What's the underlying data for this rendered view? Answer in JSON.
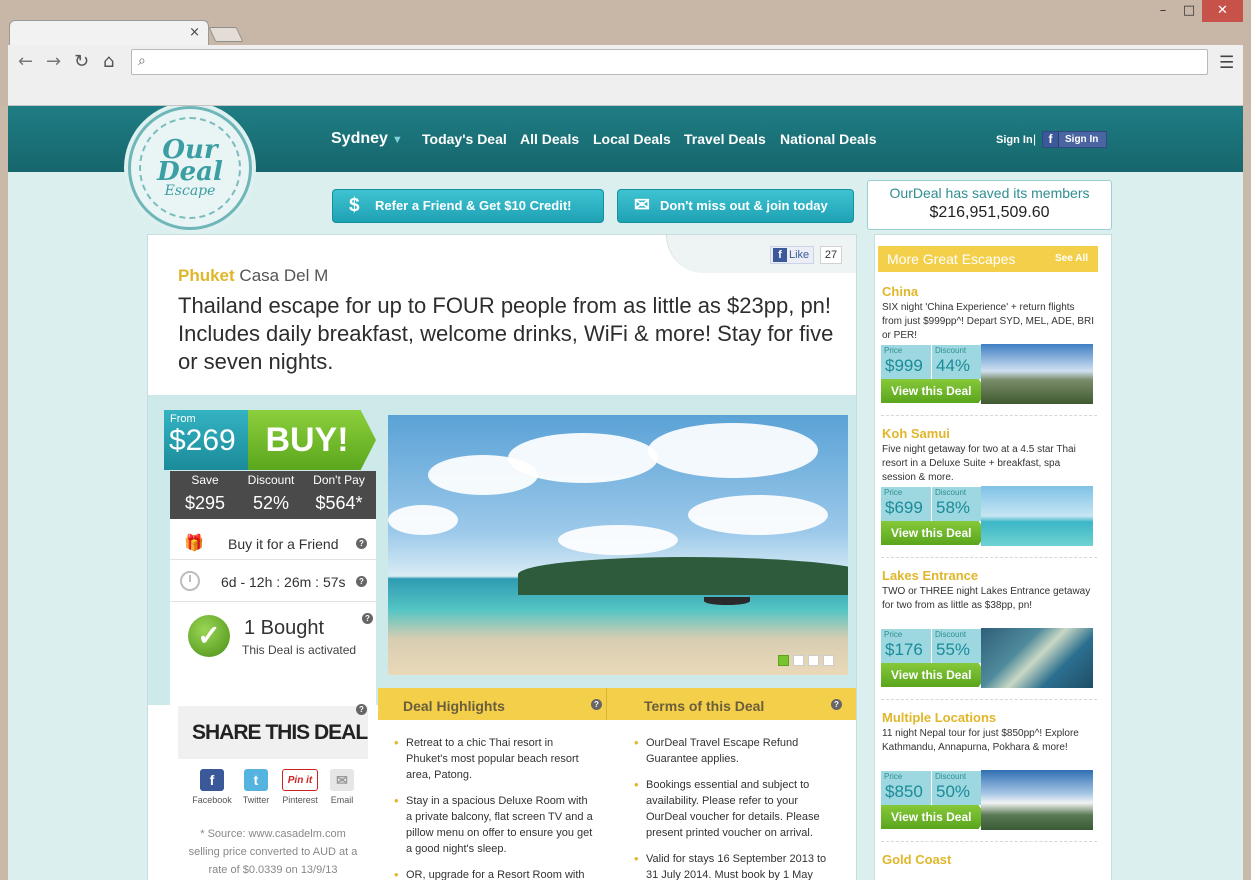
{
  "browser": {
    "tab_close": "×",
    "window_controls": {
      "minimize": "–",
      "maximize": "□",
      "close": "✕"
    },
    "address_value": ""
  },
  "header": {
    "logo_line1": "Our",
    "logo_line2": "Deal",
    "logo_line3": "Escape",
    "city": "Sydney",
    "nav": [
      "Today's Deal",
      "All Deals",
      "Local Deals",
      "Travel Deals",
      "National Deals"
    ],
    "sign_in": "Sign In",
    "fb_sign_in": "Sign In"
  },
  "cta": {
    "refer": "Refer a Friend & Get $10 Credit!",
    "join": "Don't miss out & join today"
  },
  "saved": {
    "label": "OurDeal has saved its members",
    "amount": "$216,951,509.60"
  },
  "deal": {
    "fb_like": "Like",
    "fb_count": "27",
    "location_highlight": "Phuket",
    "location_rest": "Casa Del M",
    "headline": "Thailand escape for up to FOUR people from as little as $23pp, pn! Includes daily breakfast, welcome drinks, WiFi & more! Stay for five or seven nights.",
    "from_label": "From",
    "price": "$269",
    "buy_label": "BUY!",
    "stats": {
      "headers": [
        "Save",
        "Discount",
        "Don't Pay"
      ],
      "values": [
        "$295",
        "52%",
        "$564*"
      ]
    },
    "buy_friend": "Buy it for a Friend",
    "timer": "6d - 12h : 26m : 57s",
    "bought": "1 Bought",
    "activated": "This Deal is activated",
    "share_title": "SHARE THIS DEAL",
    "share": [
      "Facebook",
      "Twitter",
      "Pinterest",
      "Email"
    ],
    "source": "* Source: www.casadelm.com selling price converted to AUD at a rate of $0.0339 on 13/9/13",
    "highlights_title": "Deal Highlights",
    "terms_title": "Terms of this Deal",
    "highlights": [
      "Retreat to a chic Thai resort in Phuket's most popular beach resort area, Patong.",
      "Stay in a spacious Deluxe Room with a private balcony, flat screen TV and a pillow menu on offer to ensure you get a good night's sleep.",
      "OR, upgrade for a Resort Room with"
    ],
    "terms": [
      "OurDeal Travel Escape Refund Guarantee applies.",
      "Bookings essential and subject to availability. Please refer to your OurDeal voucher for details. Please present printed voucher on arrival.",
      "Valid for stays 16 September 2013 to 31 July 2014. Must book by 1 May"
    ]
  },
  "sidebar": {
    "title": "More Great Escapes",
    "see_all": "See All",
    "price_label": "Price",
    "discount_label": "Discount",
    "button_label": "View this Deal",
    "escapes": [
      {
        "title": "China",
        "desc": "SIX night 'China Experience' + return flights from just $999pp^! Depart SYD, MEL, ADE, BRI or PER!",
        "price": "$999",
        "discount": "44%"
      },
      {
        "title": "Koh Samui",
        "desc": "Five night getaway for two at a 4.5 star Thai resort in a Deluxe Suite + breakfast, spa session & more.",
        "price": "$699",
        "discount": "58%"
      },
      {
        "title": "Lakes Entrance",
        "desc": "TWO or THREE night Lakes Entrance getaway for two from as little as $38pp, pn!",
        "price": "$176",
        "discount": "55%"
      },
      {
        "title": "Multiple Locations",
        "desc": "11 night Nepal tour for just $850pp^! Explore Kathmandu, Annapurna, Pokhara & more!",
        "price": "$850",
        "discount": "50%"
      },
      {
        "title": "Gold Coast",
        "desc": ""
      }
    ]
  }
}
